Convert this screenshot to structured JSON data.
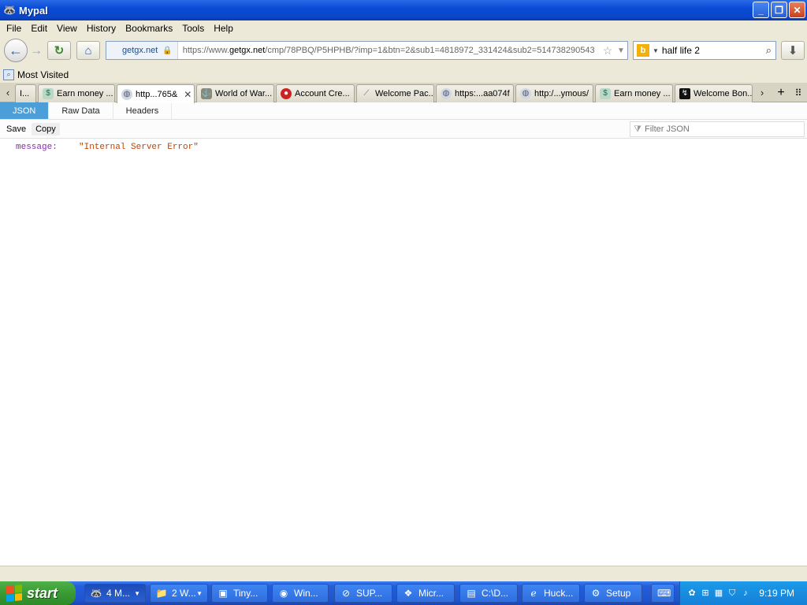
{
  "window": {
    "title": "Mypal"
  },
  "menu": [
    "File",
    "Edit",
    "View",
    "History",
    "Bookmarks",
    "Tools",
    "Help"
  ],
  "nav": {
    "identity": "getgx.net",
    "url_prefix": "https://www.",
    "url_domain": "getgx.net",
    "url_rest": "/cmp/78PBQ/P5HPHB/?imp=1&btn=2&sub1=4818972_331424&sub2=514738290543",
    "search_value": "half life 2"
  },
  "bookmarks": {
    "most_visited": "Most Visited"
  },
  "tabs": [
    {
      "label": "I...",
      "icon": "page-icon",
      "active": false
    },
    {
      "label": "Earn money ...",
      "icon": "money-icon",
      "active": false
    },
    {
      "label": "http...765&",
      "icon": "globe-icon",
      "active": true
    },
    {
      "label": "World of War...",
      "icon": "wows-icon",
      "active": false
    },
    {
      "label": "Account Cre...",
      "icon": "red-logo-icon",
      "active": false
    },
    {
      "label": "Welcome Pac...",
      "icon": "feather-icon",
      "active": false
    },
    {
      "label": "https:...aa074f",
      "icon": "globe-icon",
      "active": false
    },
    {
      "label": "http:/...ymous/",
      "icon": "globe-icon",
      "active": false
    },
    {
      "label": "Earn money ...",
      "icon": "money-icon",
      "active": false
    },
    {
      "label": "Welcome Bon...",
      "icon": "black-logo-icon",
      "active": false
    }
  ],
  "json_viewer": {
    "tabs": [
      "JSON",
      "Raw Data",
      "Headers"
    ],
    "actions": [
      "Save",
      "Copy"
    ],
    "filter_placeholder": "Filter JSON",
    "rows": [
      {
        "key": "message:",
        "value": "\"Internal Server Error\""
      }
    ]
  },
  "taskbar": {
    "start": "start",
    "tasks": [
      {
        "label": "4 M...",
        "icon": "mypal-icon",
        "group": true,
        "pressed": true
      },
      {
        "label": "2 W...",
        "icon": "folder-icon",
        "group": true,
        "pressed": false
      },
      {
        "label": "Tiny...",
        "icon": "app-icon",
        "group": false,
        "pressed": false
      },
      {
        "label": "Win...",
        "icon": "media-icon",
        "group": false,
        "pressed": false
      },
      {
        "label": "SUP...",
        "icon": "no-icon",
        "group": false,
        "pressed": false
      },
      {
        "label": "Micr...",
        "icon": "ms-icon",
        "group": false,
        "pressed": false
      },
      {
        "label": "C:\\D...",
        "icon": "console-icon",
        "group": false,
        "pressed": false
      },
      {
        "label": "Huck...",
        "icon": "ie-icon",
        "group": false,
        "pressed": false
      },
      {
        "label": "Setup",
        "icon": "setup-icon",
        "group": false,
        "pressed": false
      }
    ],
    "clock": "9:19 PM"
  }
}
